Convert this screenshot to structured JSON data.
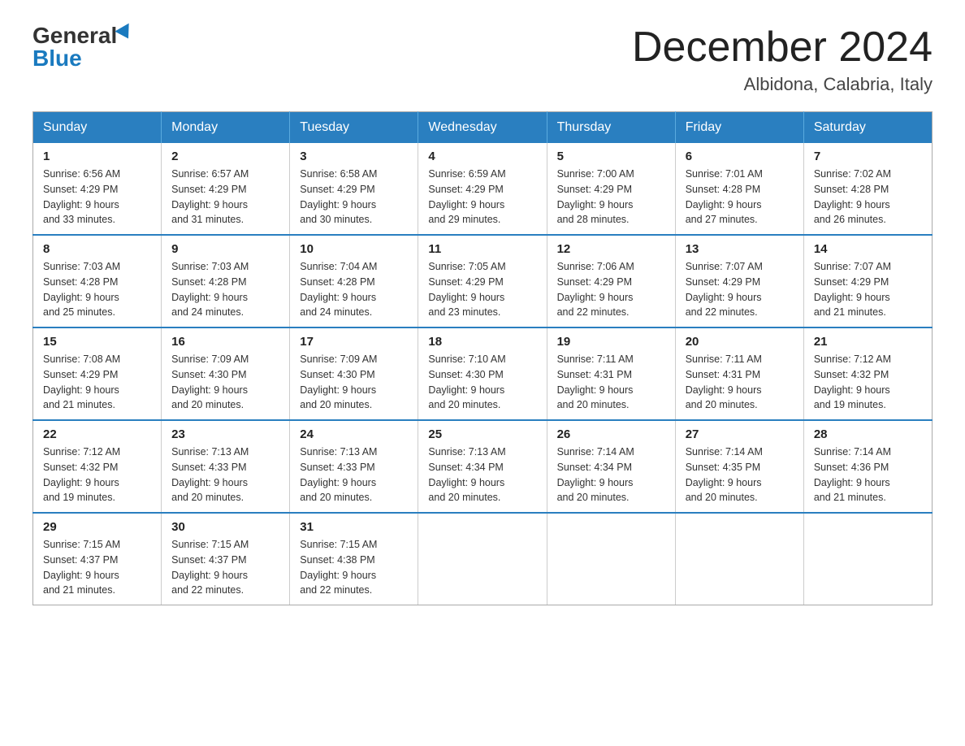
{
  "header": {
    "logo_general": "General",
    "logo_blue": "Blue",
    "title": "December 2024",
    "location": "Albidona, Calabria, Italy"
  },
  "days_of_week": [
    "Sunday",
    "Monday",
    "Tuesday",
    "Wednesday",
    "Thursday",
    "Friday",
    "Saturday"
  ],
  "weeks": [
    [
      {
        "day": "1",
        "sunrise": "6:56 AM",
        "sunset": "4:29 PM",
        "daylight": "9 hours and 33 minutes."
      },
      {
        "day": "2",
        "sunrise": "6:57 AM",
        "sunset": "4:29 PM",
        "daylight": "9 hours and 31 minutes."
      },
      {
        "day": "3",
        "sunrise": "6:58 AM",
        "sunset": "4:29 PM",
        "daylight": "9 hours and 30 minutes."
      },
      {
        "day": "4",
        "sunrise": "6:59 AM",
        "sunset": "4:29 PM",
        "daylight": "9 hours and 29 minutes."
      },
      {
        "day": "5",
        "sunrise": "7:00 AM",
        "sunset": "4:29 PM",
        "daylight": "9 hours and 28 minutes."
      },
      {
        "day": "6",
        "sunrise": "7:01 AM",
        "sunset": "4:28 PM",
        "daylight": "9 hours and 27 minutes."
      },
      {
        "day": "7",
        "sunrise": "7:02 AM",
        "sunset": "4:28 PM",
        "daylight": "9 hours and 26 minutes."
      }
    ],
    [
      {
        "day": "8",
        "sunrise": "7:03 AM",
        "sunset": "4:28 PM",
        "daylight": "9 hours and 25 minutes."
      },
      {
        "day": "9",
        "sunrise": "7:03 AM",
        "sunset": "4:28 PM",
        "daylight": "9 hours and 24 minutes."
      },
      {
        "day": "10",
        "sunrise": "7:04 AM",
        "sunset": "4:28 PM",
        "daylight": "9 hours and 24 minutes."
      },
      {
        "day": "11",
        "sunrise": "7:05 AM",
        "sunset": "4:29 PM",
        "daylight": "9 hours and 23 minutes."
      },
      {
        "day": "12",
        "sunrise": "7:06 AM",
        "sunset": "4:29 PM",
        "daylight": "9 hours and 22 minutes."
      },
      {
        "day": "13",
        "sunrise": "7:07 AM",
        "sunset": "4:29 PM",
        "daylight": "9 hours and 22 minutes."
      },
      {
        "day": "14",
        "sunrise": "7:07 AM",
        "sunset": "4:29 PM",
        "daylight": "9 hours and 21 minutes."
      }
    ],
    [
      {
        "day": "15",
        "sunrise": "7:08 AM",
        "sunset": "4:29 PM",
        "daylight": "9 hours and 21 minutes."
      },
      {
        "day": "16",
        "sunrise": "7:09 AM",
        "sunset": "4:30 PM",
        "daylight": "9 hours and 20 minutes."
      },
      {
        "day": "17",
        "sunrise": "7:09 AM",
        "sunset": "4:30 PM",
        "daylight": "9 hours and 20 minutes."
      },
      {
        "day": "18",
        "sunrise": "7:10 AM",
        "sunset": "4:30 PM",
        "daylight": "9 hours and 20 minutes."
      },
      {
        "day": "19",
        "sunrise": "7:11 AM",
        "sunset": "4:31 PM",
        "daylight": "9 hours and 20 minutes."
      },
      {
        "day": "20",
        "sunrise": "7:11 AM",
        "sunset": "4:31 PM",
        "daylight": "9 hours and 20 minutes."
      },
      {
        "day": "21",
        "sunrise": "7:12 AM",
        "sunset": "4:32 PM",
        "daylight": "9 hours and 19 minutes."
      }
    ],
    [
      {
        "day": "22",
        "sunrise": "7:12 AM",
        "sunset": "4:32 PM",
        "daylight": "9 hours and 19 minutes."
      },
      {
        "day": "23",
        "sunrise": "7:13 AM",
        "sunset": "4:33 PM",
        "daylight": "9 hours and 20 minutes."
      },
      {
        "day": "24",
        "sunrise": "7:13 AM",
        "sunset": "4:33 PM",
        "daylight": "9 hours and 20 minutes."
      },
      {
        "day": "25",
        "sunrise": "7:13 AM",
        "sunset": "4:34 PM",
        "daylight": "9 hours and 20 minutes."
      },
      {
        "day": "26",
        "sunrise": "7:14 AM",
        "sunset": "4:34 PM",
        "daylight": "9 hours and 20 minutes."
      },
      {
        "day": "27",
        "sunrise": "7:14 AM",
        "sunset": "4:35 PM",
        "daylight": "9 hours and 20 minutes."
      },
      {
        "day": "28",
        "sunrise": "7:14 AM",
        "sunset": "4:36 PM",
        "daylight": "9 hours and 21 minutes."
      }
    ],
    [
      {
        "day": "29",
        "sunrise": "7:15 AM",
        "sunset": "4:37 PM",
        "daylight": "9 hours and 21 minutes."
      },
      {
        "day": "30",
        "sunrise": "7:15 AM",
        "sunset": "4:37 PM",
        "daylight": "9 hours and 22 minutes."
      },
      {
        "day": "31",
        "sunrise": "7:15 AM",
        "sunset": "4:38 PM",
        "daylight": "9 hours and 22 minutes."
      },
      null,
      null,
      null,
      null
    ]
  ],
  "labels": {
    "sunrise": "Sunrise:",
    "sunset": "Sunset:",
    "daylight": "Daylight:"
  }
}
